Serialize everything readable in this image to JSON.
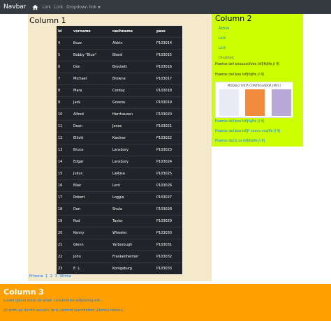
{
  "navbar": {
    "brand": "Navbar",
    "links": [
      "Link",
      "Link",
      "Dropdown link"
    ]
  },
  "col1": {
    "title": "Column 1",
    "headers": [
      "id",
      "vorname",
      "nachname",
      "pass"
    ],
    "rows": [
      [
        "4",
        "Buzz",
        "Aldrin",
        "P103014"
      ],
      [
        "5",
        "Bobby \"Blue\"",
        "Bland",
        "P103015"
      ],
      [
        "6",
        "Don",
        "Brockett",
        "P103016"
      ],
      [
        "7",
        "Michael",
        "Browne",
        "P103017"
      ],
      [
        "8",
        "Mara",
        "Corday",
        "P103018"
      ],
      [
        "9",
        "Jack",
        "Greene",
        "P103019"
      ],
      [
        "10",
        "Alfred",
        "Herrhausen",
        "P103020"
      ],
      [
        "11",
        "Dean",
        "Jones",
        "P103021"
      ],
      [
        "12",
        "Elliott",
        "Kastner",
        "P103022"
      ],
      [
        "13",
        "Bruce",
        "Lansbury",
        "P103023"
      ],
      [
        "14",
        "Edgar",
        "Lansbury",
        "P103024"
      ],
      [
        "15",
        "Julius",
        "LaRosa",
        "P103025"
      ],
      [
        "16",
        "Blair",
        "Lent",
        "P103026"
      ],
      [
        "17",
        "Robert",
        "Loggia",
        "P103027"
      ],
      [
        "18",
        "Don",
        "Shula",
        "P103028"
      ],
      [
        "19",
        "Rod",
        "Taylor",
        "P103029"
      ],
      [
        "20",
        "Kenny",
        "Wheeler",
        "P103030"
      ],
      [
        "21",
        "Glenn",
        "Yarborough",
        "P103031"
      ],
      [
        "22",
        "John",
        "Frankenheimer",
        "P103032"
      ],
      [
        "23",
        "E. L.",
        "Konigsburg",
        "P103033"
      ]
    ],
    "pager": [
      "Primera",
      "1",
      "2",
      "3",
      "Ultima"
    ]
  },
  "col2": {
    "title": "Column 2",
    "links": [
      "Active",
      "Link",
      "Link"
    ],
    "disabled": "Disabled",
    "text1": "Hueros del xxxxxxcfoos lsfljfsjlfe jl lfj",
    "text2": "Hueros del bos lsfljfsjlfe jl lfj",
    "image_title": "MODELO VISTA CONTROLADOR (MVC)",
    "text3": "Hueros del bos lsfljfsjlfe jl lfj",
    "text4": "Hueros del bos lsfljf cxxcv vcsjlfe jl lfj",
    "text5": "Hueros del b cs lsfljfsjlfe jl lfj"
  },
  "col3": {
    "title": "Column 3",
    "p1": "Lorem ipsum dolor sit amet, consectetur adipiscing elit...",
    "p2": "Ut enim ad minim veniam, quis nostrud exercitation ullamco laboris..."
  }
}
